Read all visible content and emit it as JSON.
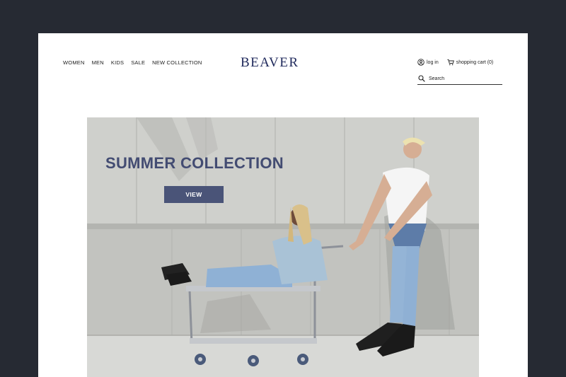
{
  "nav": {
    "items": [
      {
        "label": "WOMEN"
      },
      {
        "label": "MEN"
      },
      {
        "label": "KIDS"
      },
      {
        "label": "SALE"
      },
      {
        "label": "NEW COLLECTION"
      }
    ]
  },
  "brand": {
    "logo": "BEAVER",
    "color": "#202a5c"
  },
  "account": {
    "login_label": "log in",
    "cart_label": "shopping cart (0)",
    "login_icon": "user-icon",
    "cart_icon": "cart-icon"
  },
  "search": {
    "placeholder": "Search",
    "icon": "search-icon"
  },
  "hero": {
    "title": "SUMMER COLLECTION",
    "button_label": "VIEW",
    "title_color": "#434c72",
    "button_color": "#4a5478"
  }
}
